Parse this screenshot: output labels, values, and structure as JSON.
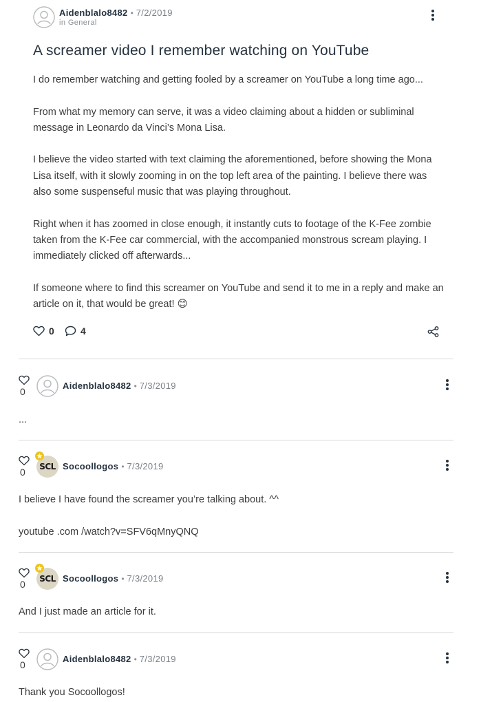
{
  "post": {
    "author": "Aidenblalo8482",
    "separator": "•",
    "date": "7/2/2019",
    "category_text": "in General",
    "title": "A screamer video I remember watching on YouTube",
    "paragraphs": [
      "I do remember watching and getting fooled by a screamer on YouTube a long time ago...",
      "From what my memory can serve, it was a video claiming about a hidden or subliminal message in Leonardo da Vinci’s Mona Lisa.",
      "I believe the video started with text claiming the aforementioned, before showing the Mona Lisa itself, with it slowly zooming in on the top left area of the painting. I believe there was also some suspenseful music that was playing throughout.",
      "Right when it has zoomed in close enough, it instantly cuts to footage of the K-Fee zombie taken from the K-Fee car commercial, with the accompanied monstrous scream playing. I immediately clicked off afterwards...",
      "If someone where to find this screamer on YouTube and send it to me in a reply and make an article on it, that would be great! 😊"
    ],
    "likes": "0",
    "comments_count": "4"
  },
  "comments": [
    {
      "author": "Aidenblalo8482",
      "separator": "•",
      "date": "7/3/2019",
      "likes": "0",
      "avatar": "default-avatar-icon",
      "badge": false,
      "lines": [
        "..."
      ]
    },
    {
      "author": "Socoollogos",
      "separator": "•",
      "date": "7/3/2019",
      "likes": "0",
      "avatar": "scl-logo",
      "avatar_text": "SCL",
      "badge": true,
      "lines": [
        "I believe I have found the screamer you’re talking about. ^^",
        "youtube .com /watch?v=SFV6qMnyQNQ"
      ]
    },
    {
      "author": "Socoollogos",
      "separator": "•",
      "date": "7/3/2019",
      "likes": "0",
      "avatar": "scl-logo",
      "avatar_text": "SCL",
      "badge": true,
      "lines": [
        "And I just made an article for it."
      ]
    },
    {
      "author": "Aidenblalo8482",
      "separator": "•",
      "date": "7/3/2019",
      "likes": "0",
      "avatar": "default-avatar-icon",
      "badge": false,
      "lines": [
        "Thank you Socoollogos!"
      ]
    }
  ],
  "colors": {
    "text": "#323232",
    "username": "#25323f",
    "muted": "#7b8187",
    "divider": "#d9dadb",
    "badge": "#f0c419"
  }
}
